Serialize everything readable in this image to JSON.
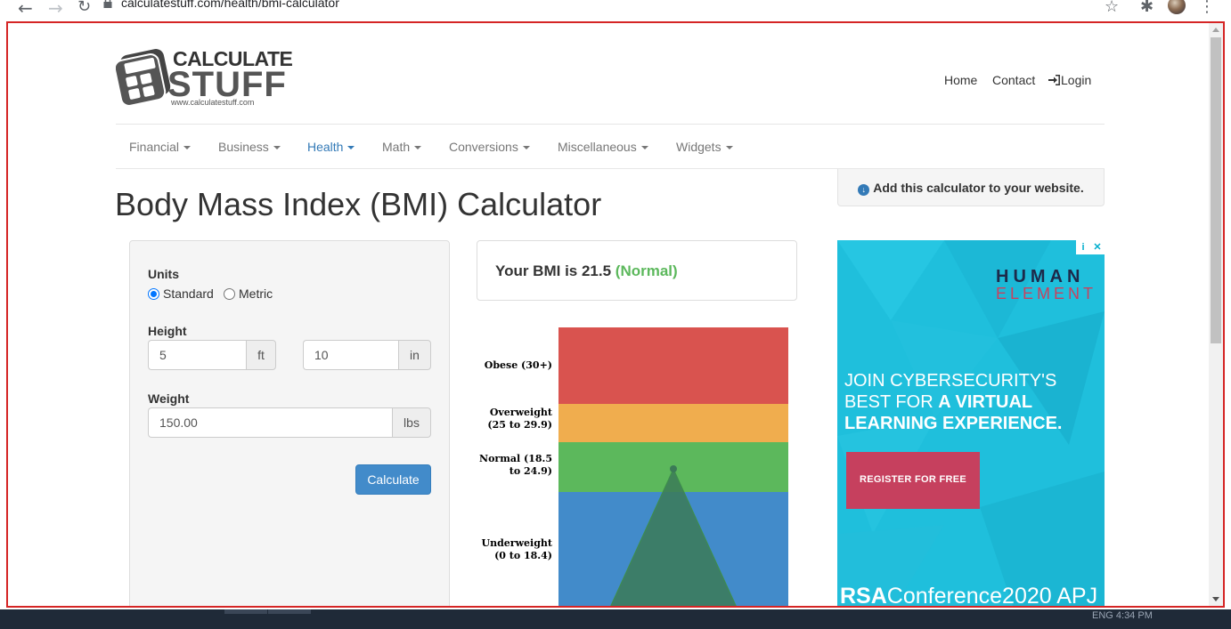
{
  "browser": {
    "url": "calculatestuff.com/health/bmi-calculator",
    "back_icon": "←",
    "forward_icon": "→",
    "reload_icon": "↻",
    "star_icon": "☆",
    "extensions_icon": "✱",
    "menu_icon": "⋮"
  },
  "taskbar": {
    "clock": "ENG   4:34 PM"
  },
  "header": {
    "logo_text_top": "CALCULATE",
    "logo_text_bottom": "STUFF",
    "logo_url": "www.calculatestuff.com",
    "links": [
      {
        "label": "Home"
      },
      {
        "label": "Contact"
      },
      {
        "label": "Login"
      }
    ]
  },
  "nav": {
    "items": [
      {
        "label": "Financial"
      },
      {
        "label": "Business"
      },
      {
        "label": "Health",
        "active": true
      },
      {
        "label": "Math"
      },
      {
        "label": "Conversions"
      },
      {
        "label": "Miscellaneous"
      },
      {
        "label": "Widgets"
      }
    ]
  },
  "add_calculator": "Add this calculator to your website.",
  "page_title": "Body Mass Index (BMI) Calculator",
  "form": {
    "units_label": "Units",
    "unit_options": [
      {
        "label": "Standard",
        "checked": true
      },
      {
        "label": "Metric",
        "checked": false
      }
    ],
    "height_label": "Height",
    "height_ft": "5",
    "height_ft_unit": "ft",
    "height_in": "10",
    "height_in_unit": "in",
    "weight_label": "Weight",
    "weight": "150.00",
    "weight_unit": "lbs",
    "calculate_label": "Calculate"
  },
  "result": {
    "prefix": "Your BMI is 21.5",
    "category": "(Normal)",
    "bmi": 21.5
  },
  "bmi_chart": {
    "zones": [
      {
        "label_line1": "Obese (30+)",
        "label_line2": "",
        "color": "#d9534f"
      },
      {
        "label_line1": "Overweight",
        "label_line2": "(25 to 29.9)",
        "color": "#f0ad4e"
      },
      {
        "label_line1": "Normal (18.5",
        "label_line2": "to 24.9)",
        "color": "#5cb85c"
      },
      {
        "label_line1": "Underweight",
        "label_line2": "(0 to 18.4)",
        "color": "#428bca"
      }
    ],
    "marker_color": "#3b7a57"
  },
  "ad": {
    "brand_line1": "HUMAN",
    "brand_line2": "ELEMENT",
    "headline_line1": "JOIN CYBERSECURITY'S",
    "headline_line2_normal": "BEST FOR ",
    "headline_line2_bold": "A VIRTUAL",
    "headline_line3_bold": "LEARNING EXPERIENCE.",
    "cta": "REGISTER FOR FREE",
    "footer_bold": "RSA",
    "footer_rest": "Conference2020 APJ",
    "info_icon": "i",
    "close_icon": "✕"
  }
}
